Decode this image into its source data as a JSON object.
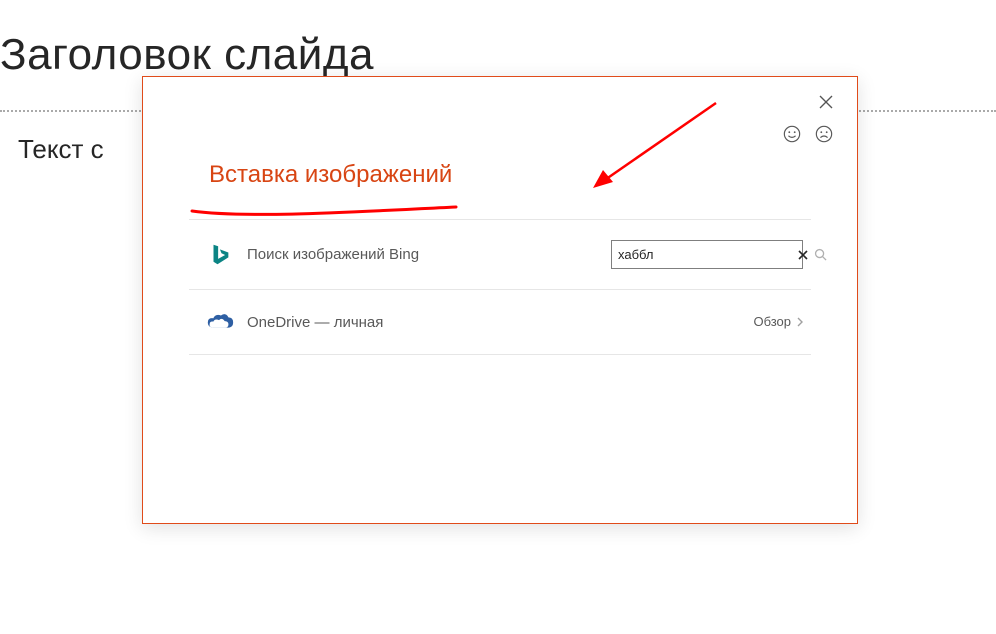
{
  "slide": {
    "title": "Заголовок слайда",
    "body_text": "Текст с"
  },
  "dialog": {
    "title": "Вставка изображений",
    "bing": {
      "label": "Поиск изображений Bing",
      "search_value": "хаббл"
    },
    "onedrive": {
      "label": "OneDrive — личная",
      "browse_label": "Обзор"
    }
  }
}
